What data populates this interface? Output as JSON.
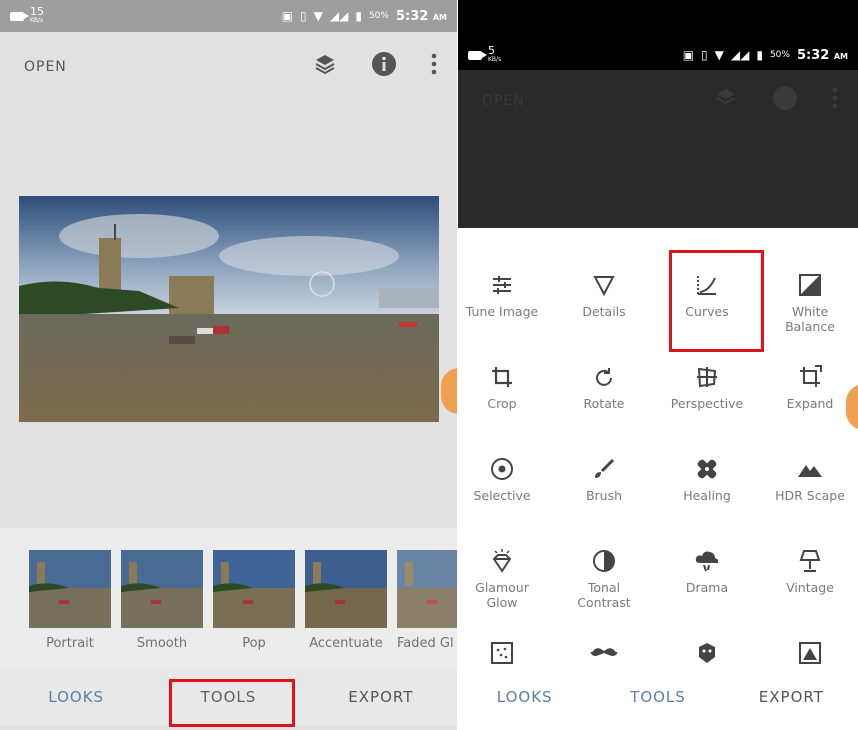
{
  "left": {
    "status": {
      "speed": "15",
      "speed_unit": "KB/s",
      "battery": "50%",
      "time": "5:32",
      "ampm": "AM"
    },
    "topbar": {
      "open_label": "OPEN"
    },
    "looks": [
      {
        "label": "Portrait"
      },
      {
        "label": "Smooth"
      },
      {
        "label": "Pop"
      },
      {
        "label": "Accentuate"
      },
      {
        "label": "Faded Gl"
      }
    ],
    "nav": {
      "looks": "LOOKS",
      "tools": "TOOLS",
      "export": "EXPORT"
    }
  },
  "right": {
    "status": {
      "speed": "5",
      "speed_unit": "KB/s",
      "battery": "50%",
      "time": "5:32",
      "ampm": "AM"
    },
    "topbar": {
      "open_label": "OPEN"
    },
    "tools": [
      {
        "label": "Tune Image",
        "icon": "sliders-icon"
      },
      {
        "label": "Details",
        "icon": "triangle-icon"
      },
      {
        "label": "Curves",
        "icon": "curves-icon"
      },
      {
        "label": "White\nBalance",
        "icon": "white-balance-icon"
      },
      {
        "label": "Crop",
        "icon": "crop-icon"
      },
      {
        "label": "Rotate",
        "icon": "rotate-icon"
      },
      {
        "label": "Perspective",
        "icon": "perspective-icon"
      },
      {
        "label": "Expand",
        "icon": "expand-icon"
      },
      {
        "label": "Selective",
        "icon": "target-icon"
      },
      {
        "label": "Brush",
        "icon": "brush-icon"
      },
      {
        "label": "Healing",
        "icon": "bandage-icon"
      },
      {
        "label": "HDR Scape",
        "icon": "mountain-icon"
      },
      {
        "label": "Glamour\nGlow",
        "icon": "diamond-icon"
      },
      {
        "label": "Tonal\nContrast",
        "icon": "contrast-icon"
      },
      {
        "label": "Drama",
        "icon": "cloud-icon"
      },
      {
        "label": "Vintage",
        "icon": "lamp-icon"
      }
    ],
    "partial_row_icons": [
      "grain-icon",
      "mustache-icon",
      "face-icon",
      "frame-icon"
    ],
    "nav": {
      "looks": "LOOKS",
      "tools": "TOOLS",
      "export": "EXPORT"
    }
  },
  "colors": {
    "accent": "#5b7da8",
    "highlight": "#e0121b",
    "handle": "#f0a050"
  }
}
